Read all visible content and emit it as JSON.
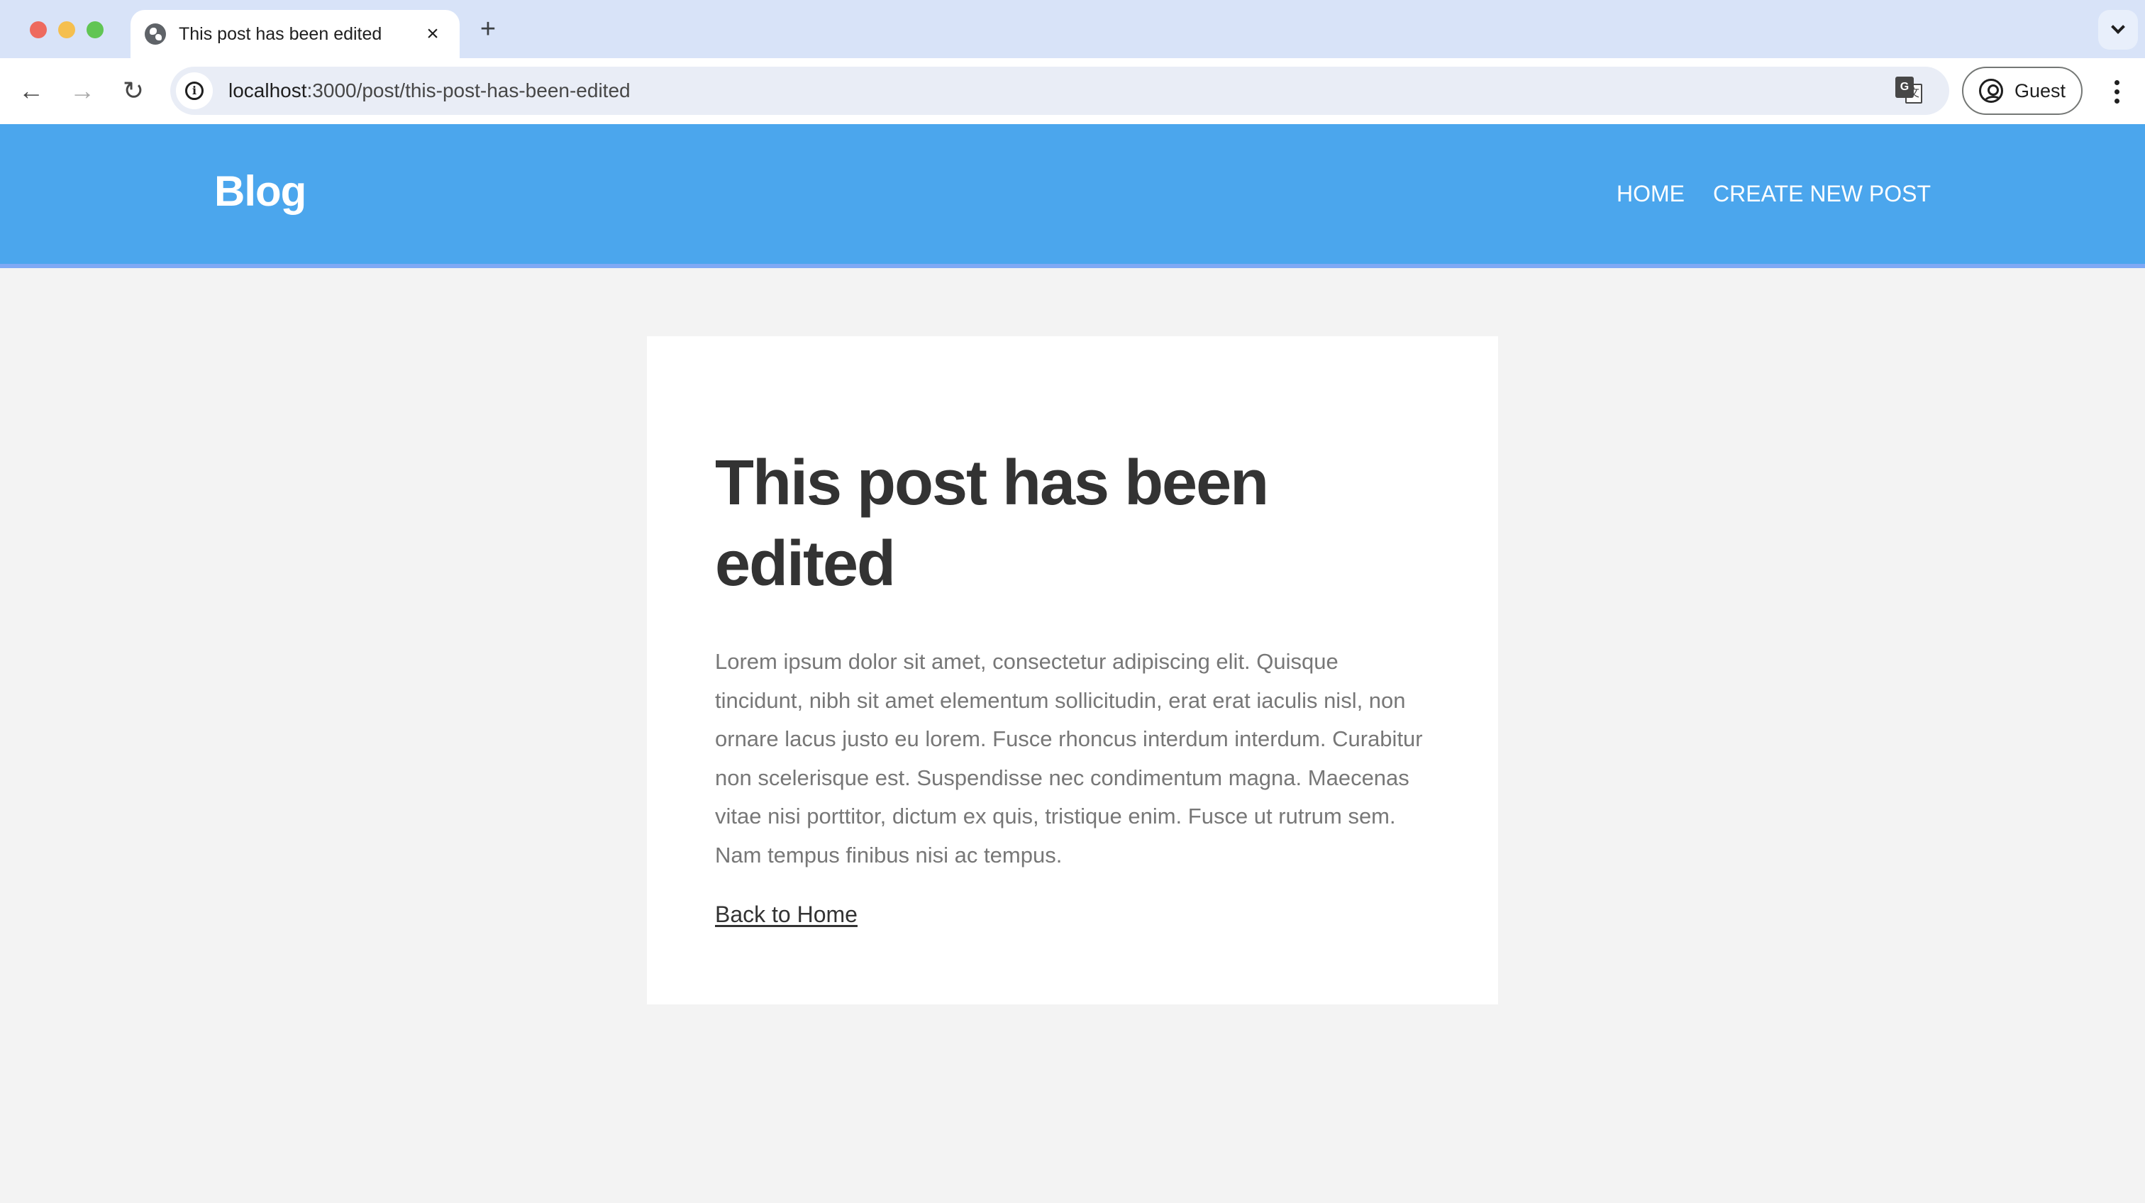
{
  "browser": {
    "tab": {
      "title": "This post has been edited",
      "icon": "globe-icon",
      "close_label": "×"
    },
    "new_tab_label": "+",
    "address": {
      "host": "localhost",
      "path": ":3000/post/this-post-has-been-edited"
    },
    "profile_label": "Guest",
    "icons": {
      "back": "←",
      "forward": "→",
      "reload": "↻",
      "info": "i",
      "translate_g": "G",
      "translate_x": "文"
    }
  },
  "site": {
    "brand": "Blog",
    "nav": [
      {
        "label": "HOME"
      },
      {
        "label": "CREATE NEW POST"
      }
    ],
    "colors": {
      "header": "#4ba6ed",
      "header_border": "#7fa9f5",
      "page_bg": "#f3f3f3",
      "title": "#333333",
      "body_text": "#777777"
    }
  },
  "post": {
    "title": "This post has been edited",
    "body": "Lorem ipsum dolor sit amet, consectetur adipiscing elit. Quisque tincidunt, nibh sit amet elementum sollicitudin, erat erat iaculis nisl, non ornare lacus justo eu lorem. Fusce rhoncus interdum interdum. Curabitur non scelerisque est. Suspendisse nec condimentum magna. Maecenas vitae nisi porttitor, dictum ex quis, tristique enim. Fusce ut rutrum sem. Nam tempus finibus nisi ac tempus.",
    "back_link": "Back to Home"
  }
}
